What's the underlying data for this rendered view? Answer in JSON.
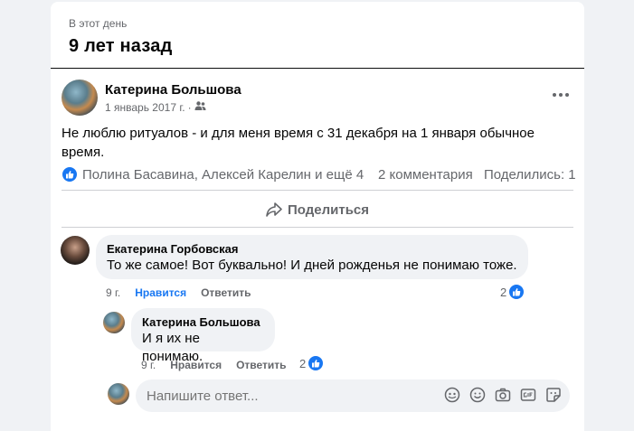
{
  "memory": {
    "label": "В этот день",
    "years": "9 лет назад"
  },
  "post": {
    "author": "Катерина Большова",
    "date": "1 январь 2017 г.",
    "audience_icon": "friends-icon",
    "text": "Не люблю ритуалов - и для меня время с 31 декабря на 1 января обычное время.",
    "reactions_text": "Полина Басавина, Алексей Карелин и ещё 4",
    "comments_count": "2 комментария",
    "shares_count": "Поделились: 1",
    "share_label": "Поделиться"
  },
  "comments": [
    {
      "author": "Екатерина Горбовская",
      "text": "То же самое! Вот буквально! И дней рожденья не понимаю тоже.",
      "time": "9 г.",
      "like_label": "Нравится",
      "reply_label": "Ответить",
      "reactions": "2"
    },
    {
      "author": "Катерина Большова",
      "text": "И я их не понимаю.",
      "time": "9 г.",
      "like_label": "Нравится",
      "reply_label": "Ответить",
      "reactions": "2"
    }
  ],
  "reply_box": {
    "placeholder": "Напишите ответ..."
  },
  "colors": {
    "accent": "#1877f2",
    "secondary_text": "#65676b",
    "bubble": "#f0f2f5"
  }
}
